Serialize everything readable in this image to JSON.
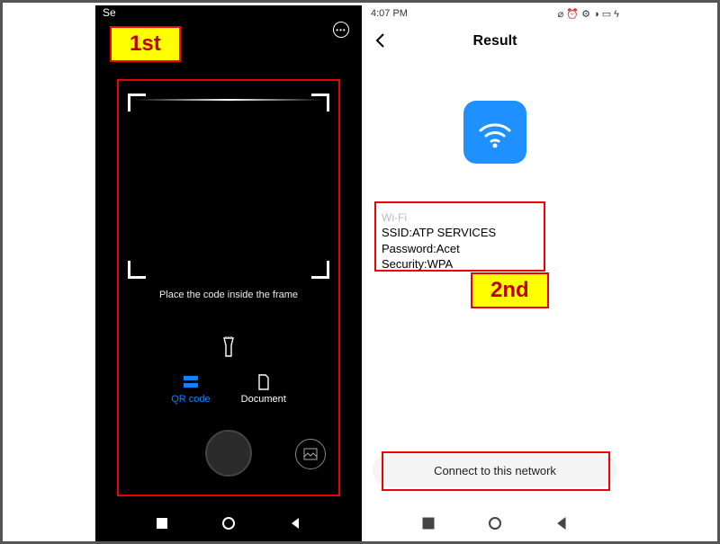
{
  "callouts": {
    "first": "1st",
    "second": "2nd"
  },
  "left": {
    "status_left": "Se",
    "more_icon": "•••",
    "scan_hint": "Place the code inside the frame",
    "modes": {
      "qr": "QR code",
      "document": "Document"
    }
  },
  "right": {
    "status": {
      "time": "4:07 PM",
      "icons": "⌀ ⏰ ⚙ ◑ ▭ ϟ"
    },
    "header_title": "Result",
    "wifi": {
      "label": "Wi-Fi",
      "ssid_line": "SSID:ATP SERVICES",
      "password_line": "Password:Acet",
      "security_line": "Security:WPA"
    },
    "connect_button": "Connect to this network"
  }
}
